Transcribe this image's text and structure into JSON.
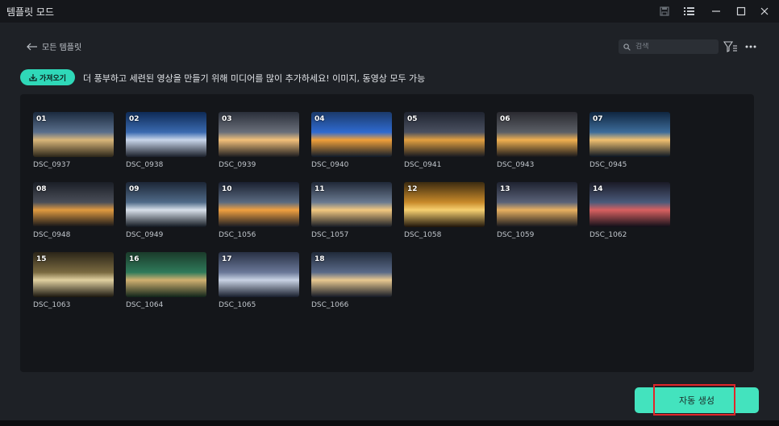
{
  "window": {
    "title": "템플릿 모드"
  },
  "header": {
    "back_label": "모든 템플릿",
    "search_placeholder": "검색"
  },
  "import": {
    "button_label": "가져오기",
    "hint": "더 풍부하고 세련된 영상을 만들기 위해 미디어를 많이 추가하세요! 이미지, 동영상 모두 가능"
  },
  "media": [
    {
      "num": "01",
      "name": "DSC_0937"
    },
    {
      "num": "02",
      "name": "DSC_0938"
    },
    {
      "num": "03",
      "name": "DSC_0939"
    },
    {
      "num": "04",
      "name": "DSC_0940"
    },
    {
      "num": "05",
      "name": "DSC_0941"
    },
    {
      "num": "06",
      "name": "DSC_0943"
    },
    {
      "num": "07",
      "name": "DSC_0945"
    },
    {
      "num": "08",
      "name": "DSC_0948"
    },
    {
      "num": "09",
      "name": "DSC_0949"
    },
    {
      "num": "10",
      "name": "DSC_1056"
    },
    {
      "num": "11",
      "name": "DSC_1057"
    },
    {
      "num": "12",
      "name": "DSC_1058"
    },
    {
      "num": "13",
      "name": "DSC_1059"
    },
    {
      "num": "14",
      "name": "DSC_1062"
    },
    {
      "num": "15",
      "name": "DSC_1063"
    },
    {
      "num": "16",
      "name": "DSC_1064"
    },
    {
      "num": "17",
      "name": "DSC_1065"
    },
    {
      "num": "18",
      "name": "DSC_1066"
    }
  ],
  "footer": {
    "auto_create_label": "자동 생성"
  },
  "colors": {
    "accent": "#43e3be",
    "highlight": "#e0262a",
    "panel": "#14161a"
  }
}
